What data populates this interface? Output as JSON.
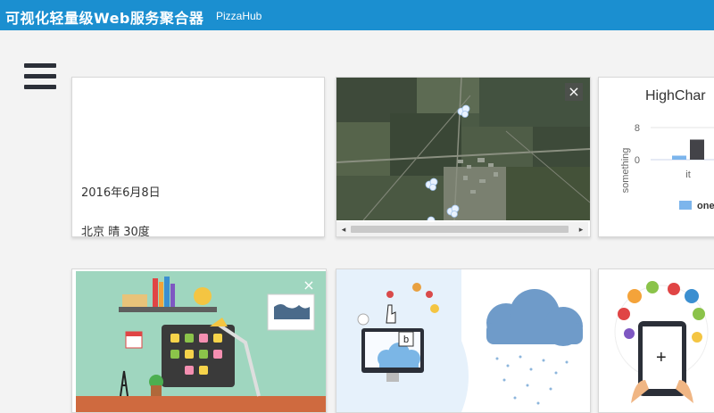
{
  "header": {
    "title": "可视化轻量级Web服务聚合器",
    "subtitle": "PizzaHub"
  },
  "menu": {
    "icon": "hamburger-menu-icon"
  },
  "cards": {
    "info": {
      "date": "2016年6月8日",
      "weather": "北京 晴 30度"
    },
    "map": {
      "close_label": "×"
    },
    "chart": {
      "chart_data": {
        "type": "bar",
        "title": "HighChar",
        "ylabel": "something",
        "categories": [
          "it"
        ],
        "series": [
          {
            "name": "one",
            "values": [
              1
            ],
            "color": "#7cb5ec"
          },
          {
            "values": [
              5
            ],
            "color": "#434348"
          }
        ],
        "yticks": [
          "0",
          "8"
        ],
        "ylim": [
          0,
          8
        ]
      }
    },
    "desk": {
      "close_label": "×"
    }
  },
  "colors": {
    "header": "#1b8fd0",
    "bar1": "#7cb5ec",
    "bar2": "#434348"
  }
}
